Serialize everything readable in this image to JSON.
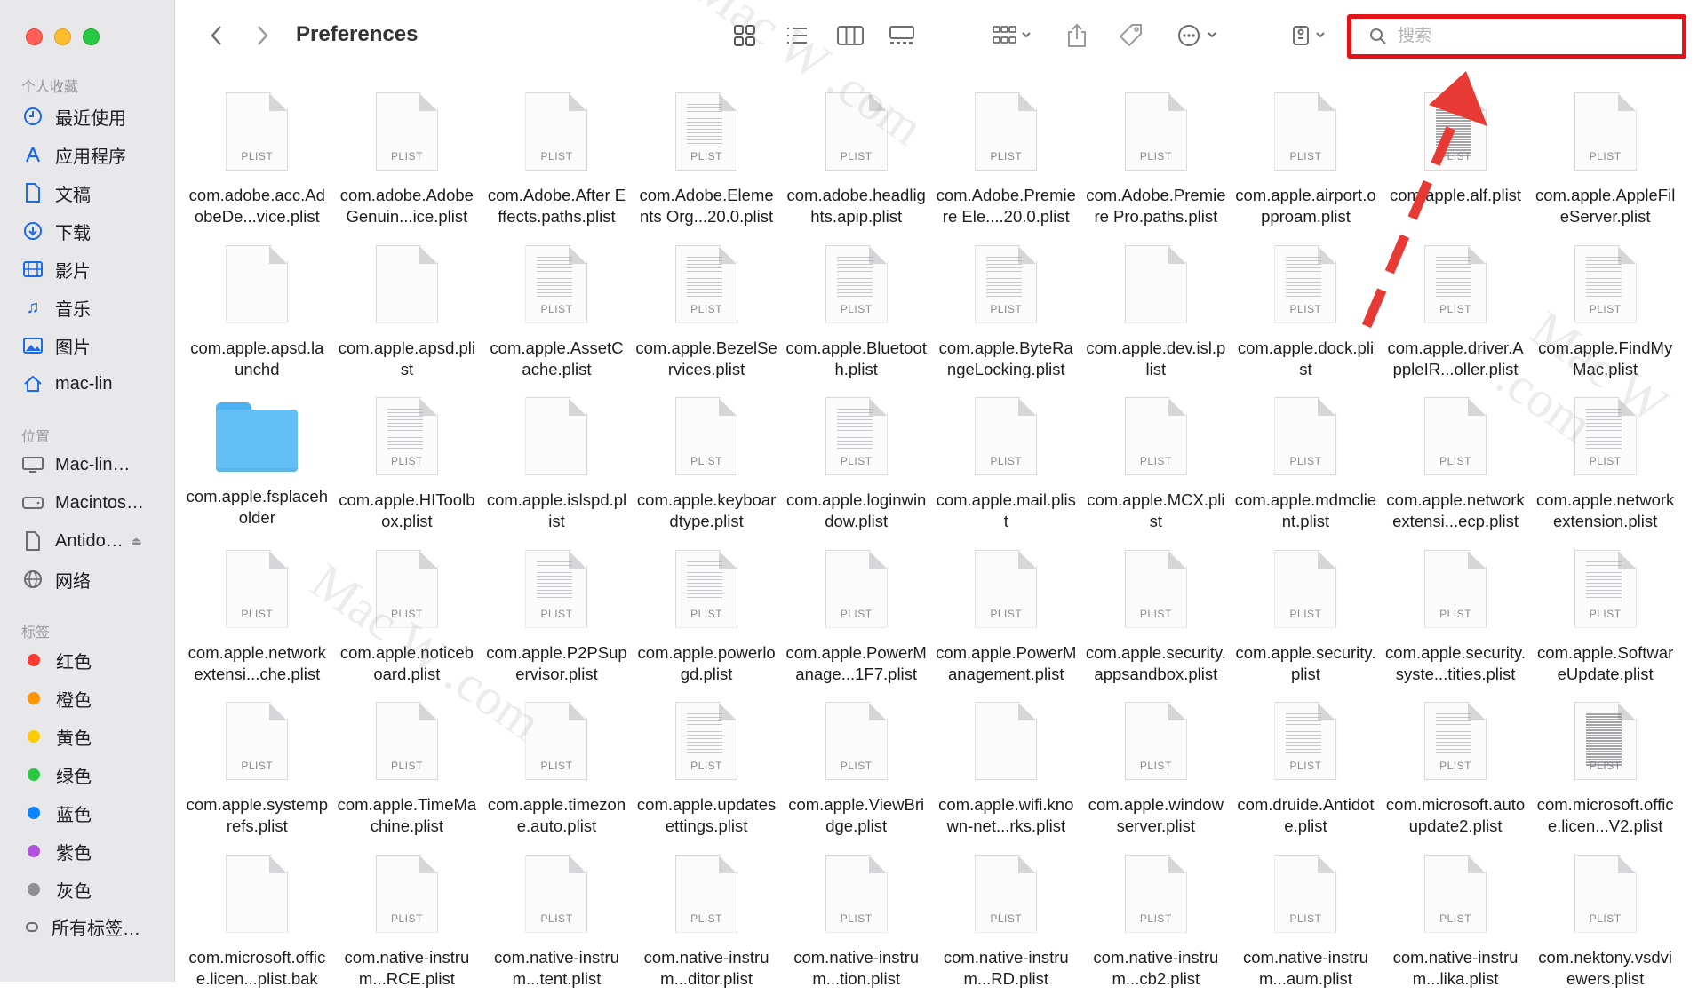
{
  "window": {
    "title": "Preferences"
  },
  "sidebar": {
    "favorites_label": "个人收藏",
    "favorites": [
      {
        "label": "最近使用",
        "icon": "clock-icon"
      },
      {
        "label": "应用程序",
        "icon": "applications-icon"
      },
      {
        "label": "文稿",
        "icon": "document-icon"
      },
      {
        "label": "下载",
        "icon": "download-icon"
      },
      {
        "label": "影片",
        "icon": "film-icon"
      },
      {
        "label": "音乐",
        "icon": "music-icon"
      },
      {
        "label": "图片",
        "icon": "photo-icon"
      },
      {
        "label": "mac-lin",
        "icon": "home-icon"
      }
    ],
    "locations_label": "位置",
    "locations": [
      {
        "label": "Mac-lin…",
        "icon": "computer-icon"
      },
      {
        "label": "Macintos…",
        "icon": "disk-icon"
      },
      {
        "label": "Antido…",
        "icon": "file-icon"
      },
      {
        "label": "网络",
        "icon": "globe-icon"
      }
    ],
    "tags_label": "标签",
    "tags": [
      {
        "label": "红色",
        "color": "#ff3b30"
      },
      {
        "label": "橙色",
        "color": "#ff9500"
      },
      {
        "label": "黄色",
        "color": "#ffcc00"
      },
      {
        "label": "绿色",
        "color": "#28c840"
      },
      {
        "label": "蓝色",
        "color": "#0a84ff"
      },
      {
        "label": "紫色",
        "color": "#af52de"
      },
      {
        "label": "灰色",
        "color": "#8e8e93"
      }
    ],
    "all_tags_label": "所有标签…"
  },
  "search": {
    "placeholder": "搜索",
    "value": ""
  },
  "watermark": "Mac W .com",
  "doc_badge": "PLIST",
  "files": [
    {
      "name": "com.adobe.acc.AdobeDe...vice.plist",
      "kind": "plain"
    },
    {
      "name": "com.adobe.AdobeGenuin...ice.plist",
      "kind": "plain"
    },
    {
      "name": "com.Adobe.After Effects.paths.plist",
      "kind": "plain"
    },
    {
      "name": "com.Adobe.Elements Org...20.0.plist",
      "kind": "lines"
    },
    {
      "name": "com.adobe.headlights.apip.plist",
      "kind": "plain"
    },
    {
      "name": "com.Adobe.Premiere Ele....20.0.plist",
      "kind": "plain"
    },
    {
      "name": "com.Adobe.Premiere Pro.paths.plist",
      "kind": "plain"
    },
    {
      "name": "com.apple.airport.opproam.plist",
      "kind": "plain"
    },
    {
      "name": "com.apple.alf.plist",
      "kind": "dense"
    },
    {
      "name": "com.apple.AppleFileServer.plist",
      "kind": "plain"
    },
    {
      "name": "com.apple.apsd.launchd",
      "kind": "blank"
    },
    {
      "name": "com.apple.apsd.plist",
      "kind": "blank"
    },
    {
      "name": "com.apple.AssetCache.plist",
      "kind": "lines"
    },
    {
      "name": "com.apple.BezelServices.plist",
      "kind": "lines"
    },
    {
      "name": "com.apple.Bluetooth.plist",
      "kind": "lines"
    },
    {
      "name": "com.apple.ByteRangeLocking.plist",
      "kind": "lines"
    },
    {
      "name": "com.apple.dev.isl.plist",
      "kind": "blank"
    },
    {
      "name": "com.apple.dock.plist",
      "kind": "lines"
    },
    {
      "name": "com.apple.driver.AppleIR...oller.plist",
      "kind": "lines"
    },
    {
      "name": "com.apple.FindMyMac.plist",
      "kind": "lines"
    },
    {
      "name": "com.apple.fsplaceholder",
      "kind": "folder"
    },
    {
      "name": "com.apple.HIToolbox.plist",
      "kind": "lines"
    },
    {
      "name": "com.apple.islspd.plist",
      "kind": "blank"
    },
    {
      "name": "com.apple.keyboardtype.plist",
      "kind": "plain"
    },
    {
      "name": "com.apple.loginwindow.plist",
      "kind": "lines"
    },
    {
      "name": "com.apple.mail.plist",
      "kind": "plain"
    },
    {
      "name": "com.apple.MCX.plist",
      "kind": "plain"
    },
    {
      "name": "com.apple.mdmclient.plist",
      "kind": "plain"
    },
    {
      "name": "com.apple.networkextensi...ecp.plist",
      "kind": "plain"
    },
    {
      "name": "com.apple.networkextension.plist",
      "kind": "lines"
    },
    {
      "name": "com.apple.networkextensi...che.plist",
      "kind": "plain"
    },
    {
      "name": "com.apple.noticeboard.plist",
      "kind": "plain"
    },
    {
      "name": "com.apple.P2PSupervisor.plist",
      "kind": "lines"
    },
    {
      "name": "com.apple.powerlogd.plist",
      "kind": "lines"
    },
    {
      "name": "com.apple.PowerManage...1F7.plist",
      "kind": "plain"
    },
    {
      "name": "com.apple.PowerManagement.plist",
      "kind": "plain"
    },
    {
      "name": "com.apple.security.appsandbox.plist",
      "kind": "plain"
    },
    {
      "name": "com.apple.security.plist",
      "kind": "plain"
    },
    {
      "name": "com.apple.security.syste...tities.plist",
      "kind": "plain"
    },
    {
      "name": "com.apple.SoftwareUpdate.plist",
      "kind": "lines"
    },
    {
      "name": "com.apple.systemprefs.plist",
      "kind": "plain"
    },
    {
      "name": "com.apple.TimeMachine.plist",
      "kind": "plain"
    },
    {
      "name": "com.apple.timezone.auto.plist",
      "kind": "plain"
    },
    {
      "name": "com.apple.updatesettings.plist",
      "kind": "lines"
    },
    {
      "name": "com.apple.ViewBridge.plist",
      "kind": "plain"
    },
    {
      "name": "com.apple.wifi.known-net...rks.plist",
      "kind": "blank"
    },
    {
      "name": "com.apple.windowserver.plist",
      "kind": "plain"
    },
    {
      "name": "com.druide.Antidote.plist",
      "kind": "lines"
    },
    {
      "name": "com.microsoft.autoupdate2.plist",
      "kind": "lines"
    },
    {
      "name": "com.microsoft.office.licen...V2.plist",
      "kind": "dense"
    },
    {
      "name": "com.microsoft.office.licen...plist.bak",
      "kind": "blank"
    },
    {
      "name": "com.native-instrum...RCE.plist",
      "kind": "plain"
    },
    {
      "name": "com.native-instrum...tent.plist",
      "kind": "plain"
    },
    {
      "name": "com.native-instrum...ditor.plist",
      "kind": "plain"
    },
    {
      "name": "com.native-instrum...tion.plist",
      "kind": "plain"
    },
    {
      "name": "com.native-instrum...RD.plist",
      "kind": "plain"
    },
    {
      "name": "com.native-instrum...cb2.plist",
      "kind": "plain"
    },
    {
      "name": "com.native-instrum...aum.plist",
      "kind": "plain"
    },
    {
      "name": "com.native-instrum...lika.plist",
      "kind": "plain"
    },
    {
      "name": "com.nektony.vsdviewers.plist",
      "kind": "plain"
    }
  ]
}
